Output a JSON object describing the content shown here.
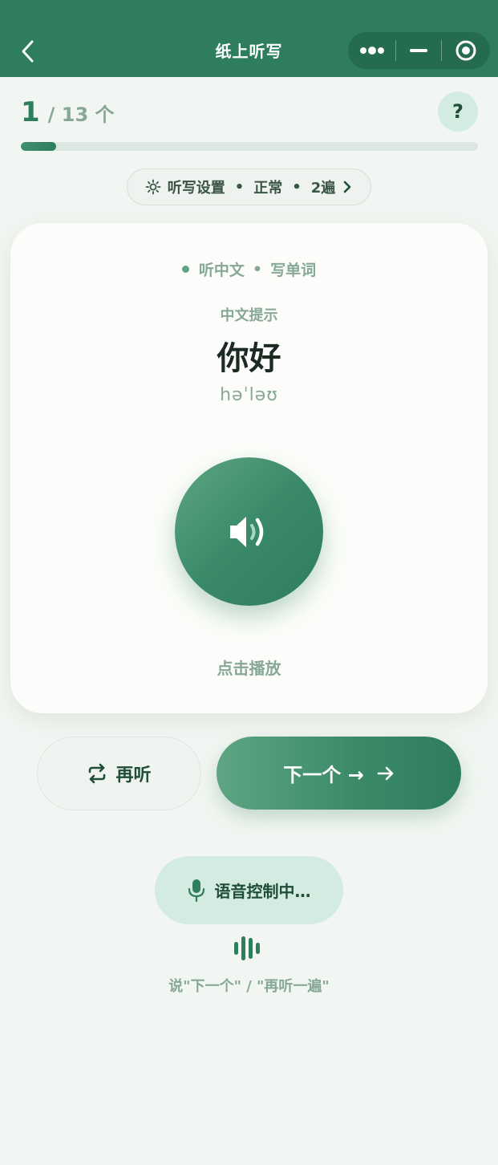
{
  "header": {
    "title": "纸上听写",
    "back_icon": "chevron-left-icon",
    "capsule": [
      "more-dots-icon",
      "minimize-icon",
      "target-close-icon"
    ]
  },
  "progress": {
    "current": "1",
    "total": "/ 13 个",
    "fraction": 0.077,
    "help_label": "?"
  },
  "settings": {
    "icon": "sun-icon",
    "label": "听写设置",
    "speed": "正常",
    "repeat": "2遍",
    "sep": "•"
  },
  "card": {
    "mode_listen": "听中文",
    "mode_sep": "•",
    "mode_write": "写单词",
    "hint_label": "中文提示",
    "word": "你好",
    "phonetic": "həˈləʊ",
    "play_icon": "speaker-icon",
    "play_label": "点击播放"
  },
  "actions": {
    "replay_icon": "repeat-icon",
    "replay_label": "再听",
    "next_label": "下一个 →",
    "next_icon": "arrow-right-icon"
  },
  "voice": {
    "icon": "microphone-icon",
    "label": "语音控制中…",
    "wave_icon": "sound-wave-icon",
    "hint": "说\"下一个\" / \"再听一遍\""
  },
  "colors": {
    "header": "#2e7d5e",
    "accent": "#2e7d5e",
    "muted": "#87a898",
    "background": "#f2f6f2"
  }
}
